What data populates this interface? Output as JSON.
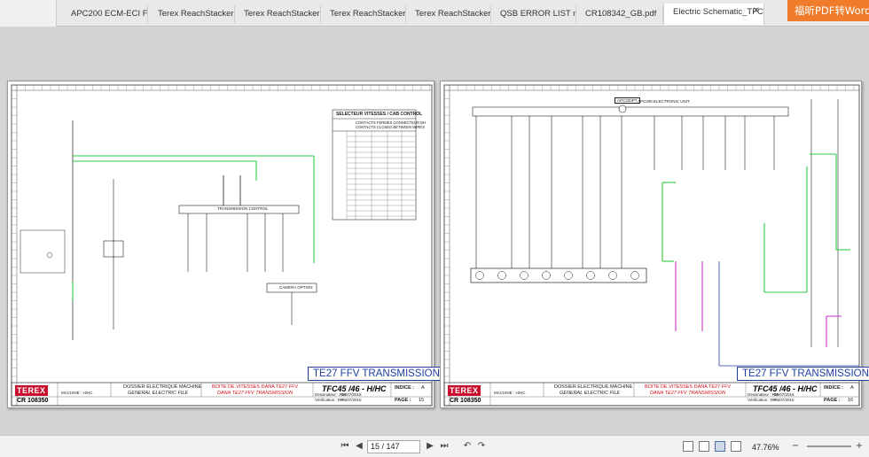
{
  "tabs": [
    {
      "label": "APC200 ECM-ECI Full ..."
    },
    {
      "label": "Terex ReachStacker ..."
    },
    {
      "label": "Terex ReachStacker ..."
    },
    {
      "label": "Terex ReachStacker ..."
    },
    {
      "label": "Terex ReachStacker ..."
    },
    {
      "label": "QSB ERROR LIST new..."
    },
    {
      "label": "CR108342_GB.pdf"
    },
    {
      "label": "Electric Schematic_TFC..."
    }
  ],
  "promo": {
    "label": "福昕PDF转Word"
  },
  "left_page": {
    "title": "TE27 FFV TRANSMISSION",
    "selector_table_title": "SELECTEUR VITESSES / CAB CONTROL",
    "selector_sub1": "CONTACTS FERMES CONNECTEUR BH",
    "selector_sub2": "CONTACTS CLOSED BETWEEN WIRES",
    "trans_control_label": "TRANSMISSION CONTROL",
    "camera_label": "CAMERA OPTION",
    "brand": "TEREX",
    "doc_number": "CR 108350",
    "dossier": "DOSSIER ELECTRIQUE MACHINE",
    "general": "GENERAL ELECTRIC FILE",
    "boite": "BOITE DE VITESSES DANA TE27 FFV",
    "dana": "DANA TE27 FFV TRANSMISSION",
    "model": "TFC45 /46 - H/HC",
    "indice_label": "INDICE :",
    "indice": "A",
    "page_label": "PAGE :",
    "page": "15",
    "machine": "MACHINE : H/HC",
    "dessinateur": "Dessinateur : RM",
    "verification": "Vérification : RP",
    "date1": "06/07/2015",
    "date2": "06/07/2015"
  },
  "right_page": {
    "title": "TE27 FFV TRANSMISSION",
    "apc_label": "APC200 ELECTRONIC UNIT",
    "apc_tag": "APC200PT",
    "brand": "TEREX",
    "doc_number": "CR 108350",
    "dossier": "DOSSIER ELECTRIQUE MACHINE",
    "general": "GENERAL ELECTRIC FILE",
    "boite": "BOITE DE VITESSES DANA TE27 FFV",
    "dana": "DANA TE27 FFV TRANSMISSION",
    "model": "TFC45 /46 - H/HC",
    "indice_label": "INDICE :",
    "indice": "A",
    "page_label": "PAGE :",
    "page": "16",
    "machine": "MACHINE : H/HC",
    "dessinateur": "Dessinateur : RM",
    "verification": "Vérification : RP",
    "date1": "06/07/2015",
    "date2": "06/07/2015"
  },
  "toolbar": {
    "page_value": "15 / 147",
    "zoom": "47.76%"
  },
  "colors": {
    "accent": "#f07b2a",
    "wire_green": "#2ecc40",
    "wire_magenta": "#cc33cc",
    "title_blue": "#1f3f9f",
    "terex_red": "#c8102e"
  }
}
